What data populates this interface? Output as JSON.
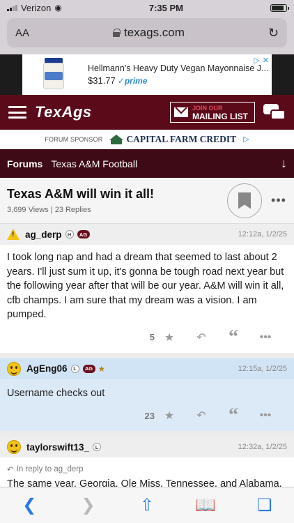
{
  "status": {
    "carrier": "Verizon",
    "time": "7:35 PM"
  },
  "address": {
    "aa": "AA",
    "domain": "texags.com"
  },
  "ad": {
    "product": "Hellmann's Heavy Duty Vegan Mayonnaise J...",
    "price": "$31.77",
    "prime": "prime"
  },
  "header": {
    "logo": "TexAgs",
    "mail_small": "JOIN OUR",
    "mail_big": "MAILING LIST"
  },
  "sponsor": {
    "label": "FORUM SPONSOR",
    "name": "CAPITAL FARM CREDIT"
  },
  "forum_nav": {
    "root": "Forums",
    "forum": "Texas A&M Football"
  },
  "thread": {
    "title": "Texas A&M will win it all!",
    "meta": "3,699 Views | 23 Replies"
  },
  "posts": [
    {
      "user": "ag_derp",
      "badges": [
        "H",
        "AG"
      ],
      "time": "12:12a, 1/2/25",
      "body": "I took long nap and had a dream that seemed to last about 2 years. I'll just sum it up, it's gonna be tough road next year but the following year after that will be our year. A&M will win it all, cfb champs. I am sure that my dream was a vision. I am pumped.",
      "likes": "5"
    },
    {
      "user": "AgEng06",
      "badges": [
        "L",
        "AG"
      ],
      "time": "12:15a, 1/2/25",
      "body": "Username checks out",
      "likes": "23"
    },
    {
      "user": "taylorswift13_",
      "badges": [
        "L"
      ],
      "time": "12:32a, 1/2/25",
      "reply_to": "In reply to ag_derp",
      "body": "The same year, Georgia, Ole Miss, Tennessee, and Alabama, and Arizona State get added to our schedule, along with Tu"
    }
  ],
  "colors": {
    "maroon": "#5b0a19",
    "dark_maroon": "#3d0a15",
    "safari_blue": "#2a7ae2"
  }
}
